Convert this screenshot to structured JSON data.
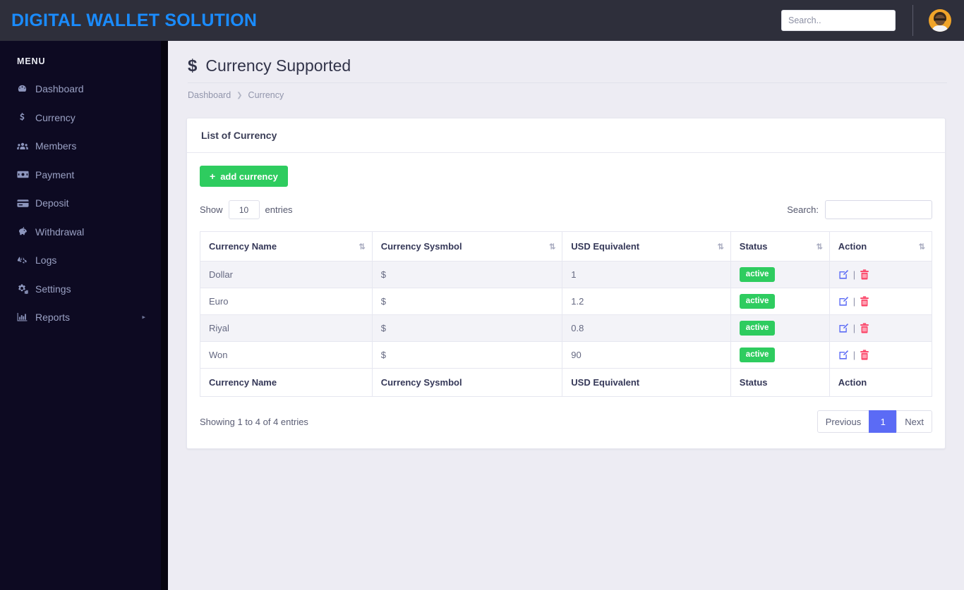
{
  "topbar": {
    "brand": "DIGITAL WALLET SOLUTION",
    "search_placeholder": "Search..",
    "search_value": "",
    "avatar_name": "user-avatar"
  },
  "sidebar": {
    "title": "MENU",
    "items": [
      {
        "label": "Dashboard",
        "icon": "dashboard-icon",
        "has_caret": false
      },
      {
        "label": "Currency",
        "icon": "dollar-icon",
        "has_caret": false
      },
      {
        "label": "Members",
        "icon": "users-icon",
        "has_caret": false
      },
      {
        "label": "Payment",
        "icon": "money-bill-icon",
        "has_caret": false
      },
      {
        "label": "Deposit",
        "icon": "credit-card-icon",
        "has_caret": false
      },
      {
        "label": "Withdrawal",
        "icon": "piggy-bank-icon",
        "has_caret": false
      },
      {
        "label": "Logs",
        "icon": "recycle-icon",
        "has_caret": false
      },
      {
        "label": "Settings",
        "icon": "cogs-icon",
        "has_caret": false
      },
      {
        "label": "Reports",
        "icon": "chart-bar-icon",
        "has_caret": true,
        "caret": "▸"
      }
    ]
  },
  "page": {
    "title": "Currency Supported",
    "title_icon": "$",
    "breadcrumb": [
      "Dashboard",
      "Currency"
    ],
    "breadcrumb_sep": "❯"
  },
  "card": {
    "header": "List of Currency",
    "add_button": "add currency",
    "add_button_icon": "+",
    "show_label": "Show",
    "entries_label": "entries",
    "page_length": "10",
    "search_label": "Search:",
    "search_value": "",
    "search_placeholder": ""
  },
  "table": {
    "columns": [
      "Currency Name",
      "Currency Sysmbol",
      "USD Equivalent",
      "Status",
      "Action"
    ],
    "sort_icon": "⇅",
    "rows": [
      {
        "name": "Dollar",
        "symbol": "$",
        "usd": "1",
        "status": "active",
        "edit_icon": "edit-icon",
        "delete_icon": "trash-icon"
      },
      {
        "name": "Euro",
        "symbol": "$",
        "usd": "1.2",
        "status": "active",
        "edit_icon": "edit-icon",
        "delete_icon": "trash-icon"
      },
      {
        "name": "Riyal",
        "symbol": "$",
        "usd": "0.8",
        "status": "active",
        "edit_icon": "edit-icon",
        "delete_icon": "trash-icon"
      },
      {
        "name": "Won",
        "symbol": "$",
        "usd": "90",
        "status": "active",
        "edit_icon": "edit-icon",
        "delete_icon": "trash-icon"
      }
    ],
    "action_separator": "|"
  },
  "footer": {
    "info": "Showing 1 to 4 of 4 entries",
    "pagination": {
      "previous": "Previous",
      "pages": [
        "1"
      ],
      "next": "Next",
      "current": "1"
    }
  },
  "colors": {
    "brand_blue": "#1a8cff",
    "topbar_bg": "#2e2f3b",
    "sidebar_bg": "#0d0a22",
    "page_bg": "#edecf3",
    "success_green": "#2ecc5f",
    "pager_active": "#5b6bf5",
    "edit_blue": "#5b6bf5",
    "delete_pink": "#fb3f63",
    "avatar_bg": "#f0a429"
  }
}
